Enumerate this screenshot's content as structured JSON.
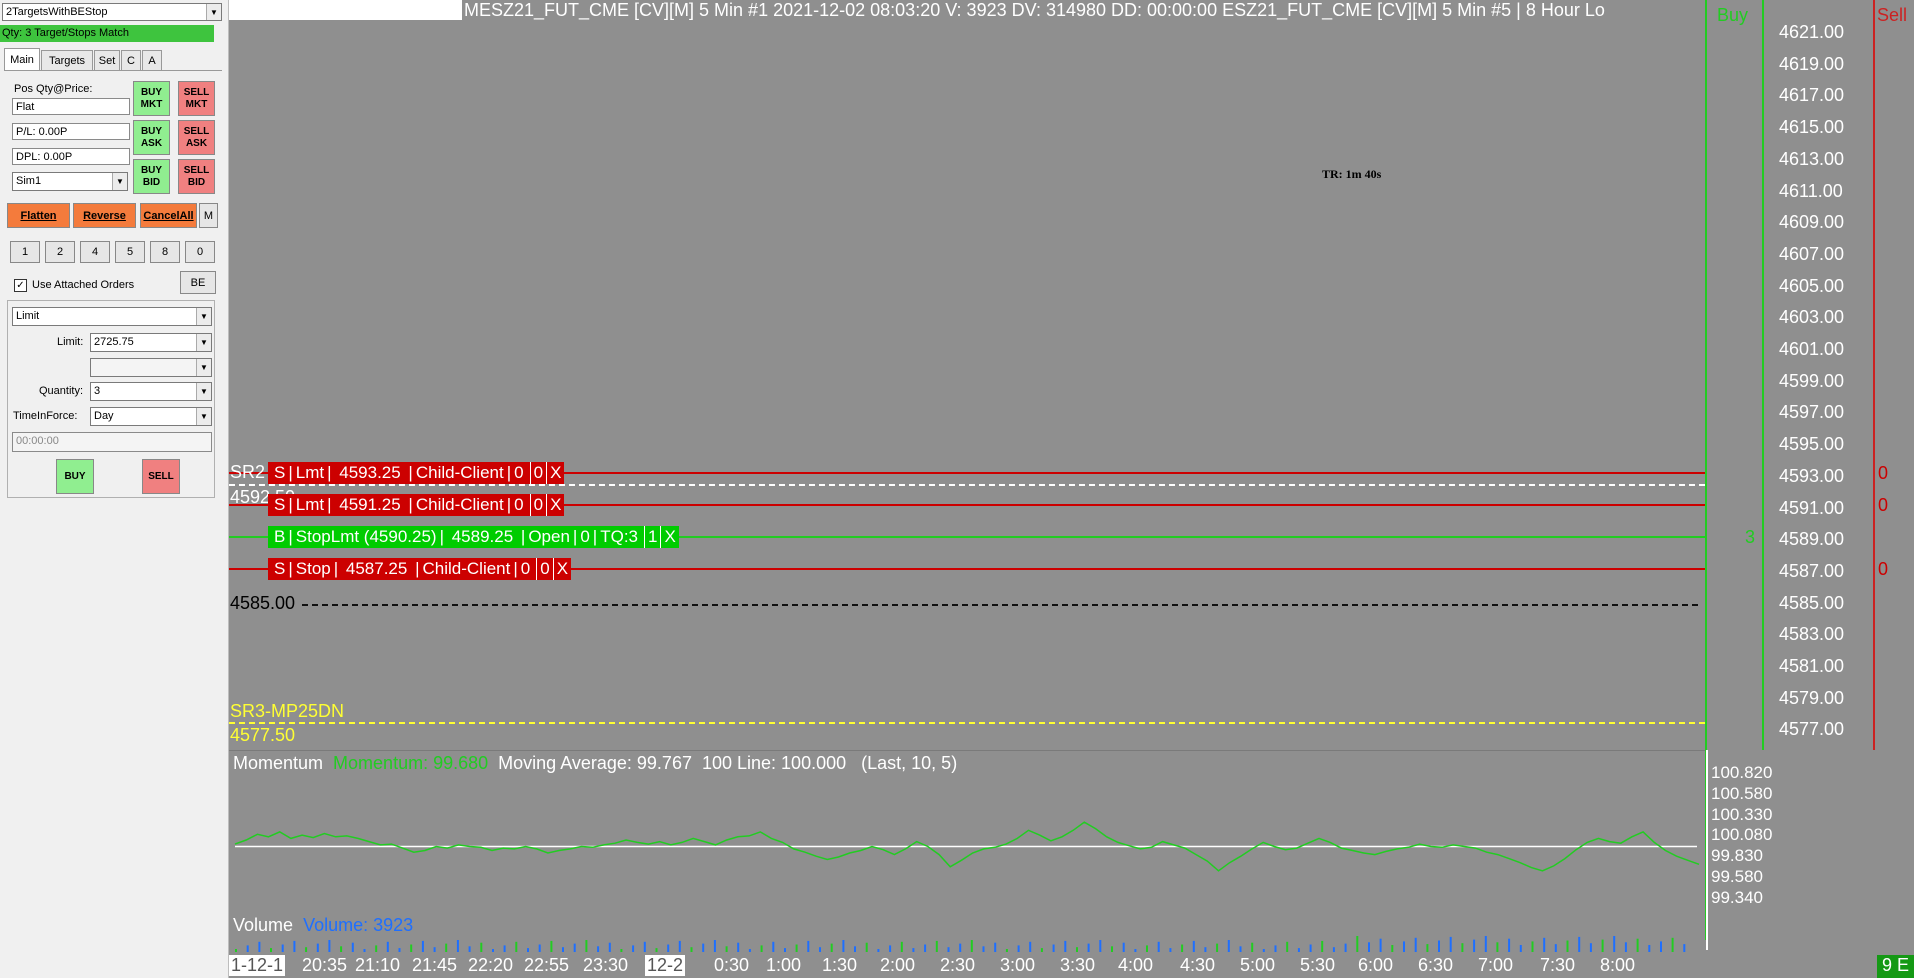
{
  "panel": {
    "strategy_select": "2TargetsWithBEStop",
    "strategy_status": "Qty: 3 Target/Stops Match",
    "tabs": [
      "Main",
      "Targets",
      "Set",
      "C",
      "A"
    ],
    "pos_label": "Pos Qty@Price:",
    "pos_value": "Flat",
    "pl_value": "P/L: 0.00P",
    "dpl_value": "DPL: 0.00P",
    "account": "Sim1",
    "buy_mkt": "BUY MKT",
    "sell_mkt": "SELL MKT",
    "buy_ask": "BUY ASK",
    "sell_ask": "SELL ASK",
    "buy_bid": "BUY BID",
    "sell_bid": "SELL BID",
    "flatten": "Flatten",
    "reverse": "Reverse",
    "cancel_all": "CancelAll",
    "m_button": "M",
    "qty_buttons": [
      "1",
      "2",
      "4",
      "5",
      "8",
      "0"
    ],
    "use_attached_orders": "Use Attached Orders",
    "be_button": "BE",
    "order_type": "Limit",
    "limit_label": "Limit:",
    "limit_value": "2725.75",
    "quantity_label": "Quantity:",
    "quantity_value": "3",
    "tif_label": "TimeInForce:",
    "tif_value": "Day",
    "time_value": "00:00:00",
    "buy_button": "BUY",
    "sell_button": "SELL"
  },
  "chart": {
    "header": "MESZ21_FUT_CME [CV][M]  5 Min  #1 2021-12-02 08:03:20 V: 3923 DV: 314980 DD: 00:00:00 ESZ21_FUT_CME [CV][M]  5 Min   #5 | 8 Hour Lo",
    "buy_col_label": "Buy",
    "sell_col_label": "Sell",
    "tr_label": "TR: 1m 40s",
    "price_axis": [
      "4621.00",
      "4619.00",
      "4617.00",
      "4615.00",
      "4613.00",
      "4611.00",
      "4609.00",
      "4607.00",
      "4605.00",
      "4603.00",
      "4601.00",
      "4599.00",
      "4597.00",
      "4595.00",
      "4593.00",
      "4591.00",
      "4589.00",
      "4587.00",
      "4585.00",
      "4583.00",
      "4581.00",
      "4579.00",
      "4577.00"
    ],
    "sr2_label": "SR2",
    "sr2_price": "4592.50",
    "level_4585": "4585.00",
    "sr3_label": "SR3-MP25DN",
    "sr3_price": "4577.50",
    "orders": [
      {
        "side": "S",
        "type": "Lmt",
        "price": "4593.25",
        "status": "Child-Client",
        "a": "0",
        "b": "0",
        "x": "X"
      },
      {
        "side": "S",
        "type": "Lmt",
        "price": "4591.25",
        "status": "Child-Client",
        "a": "0",
        "b": "0",
        "x": "X"
      },
      {
        "side": "B",
        "type": "StopLmt (4590.25)",
        "price": "4589.25",
        "status": "Open",
        "a": "0",
        "tq": "TQ:3",
        "b": "1",
        "x": "X"
      },
      {
        "side": "S",
        "type": "Stop",
        "price": "4587.25",
        "status": "Child-Client",
        "a": "0",
        "b": "0",
        "x": "X"
      }
    ],
    "sell_col_values": [
      "0",
      "0",
      "0"
    ],
    "buy_col_value": "3",
    "momentum_title": "Momentum",
    "momentum_value": "Momentum: 99.680",
    "moving_average": "Moving Average: 99.767",
    "line_100": "100 Line: 100.000",
    "momentum_params": "(Last, 10, 5)",
    "momentum_axis": [
      "100.820",
      "100.580",
      "100.330",
      "100.080",
      "99.830",
      "99.580",
      "99.340"
    ],
    "volume_title": "Volume",
    "volume_value": "Volume: 3923",
    "time_axis": [
      "1-12-1",
      "20:35",
      "21:10",
      "21:45",
      "22:20",
      "22:55",
      "23:30",
      "12-2",
      "0:30",
      "1:00",
      "1:30",
      "2:00",
      "2:30",
      "3:00",
      "3:30",
      "4:00",
      "4:30",
      "5:00",
      "5:30",
      "6:00",
      "6:30",
      "7:00",
      "7:30",
      "8:00"
    ],
    "corner_label": "9 E",
    "colors": {
      "background": "#8f8f8f",
      "sell_order": "#cc0000",
      "buy_order": "#00cc00",
      "momentum": "#22cc22",
      "volume": "#1e6fff",
      "sr": "#ffff33"
    }
  },
  "chart_data": {
    "type": "line",
    "title": "Momentum",
    "momentum": [
      100.03,
      100.08,
      100.15,
      100.12,
      100.18,
      100.1,
      100.14,
      100.11,
      100.16,
      100.12,
      100.13,
      100.1,
      100.06,
      100.02,
      100.03,
      99.98,
      99.93,
      99.95,
      100.0,
      99.98,
      100.02,
      100.0,
      99.99,
      99.95,
      99.98,
      99.97,
      100.0,
      99.97,
      99.92,
      99.95,
      99.97,
      100.0,
      99.99,
      100.02,
      100.04,
      100.08,
      100.05,
      100.03,
      100.06,
      100.02,
      100.05,
      100.1,
      100.06,
      100.02,
      100.08,
      100.12,
      100.13,
      100.18,
      100.1,
      100.05,
      99.97,
      99.93,
      99.88,
      99.84,
      99.87,
      99.92,
      99.95,
      100.0,
      99.96,
      99.9,
      99.97,
      100.06,
      100.0,
      99.9,
      99.75,
      99.83,
      99.92,
      99.97,
      99.99,
      100.03,
      100.1,
      100.2,
      100.14,
      100.07,
      100.12,
      100.2,
      100.3,
      100.22,
      100.12,
      100.05,
      100.01,
      99.97,
      99.99,
      100.06,
      100.02,
      99.98,
      99.9,
      99.82,
      99.7,
      99.8,
      99.88,
      99.97,
      100.05,
      100.0,
      99.96,
      99.98,
      100.04,
      100.1,
      100.05,
      99.98,
      99.95,
      99.92,
      99.9,
      99.94,
      99.97,
      99.99,
      100.03,
      100.0,
      99.99,
      100.02,
      100.0,
      99.98,
      99.93,
      99.9,
      99.85,
      99.8,
      99.74,
      99.7,
      99.76,
      99.85,
      99.96,
      100.05,
      100.1,
      100.06,
      100.04,
      100.12,
      100.18,
      100.05,
      99.95,
      99.88,
      99.83,
      99.78
    ],
    "hundred_line": 100.0,
    "ylim": [
      99.34,
      100.82
    ],
    "volume_series_name": "Volume"
  }
}
